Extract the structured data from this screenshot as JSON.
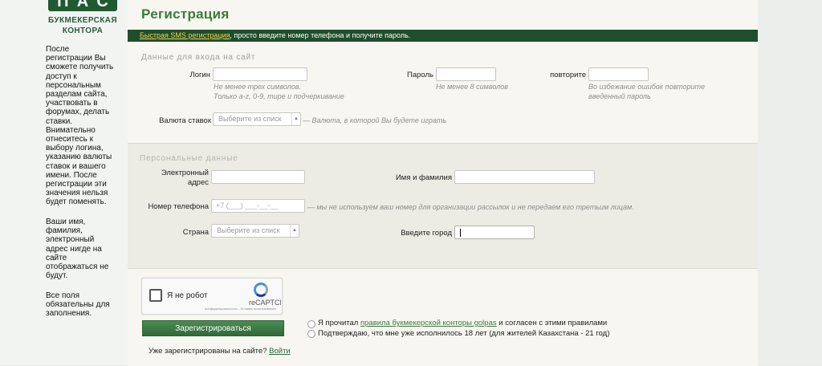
{
  "brand": {
    "logo_letters": [
      "П",
      "А",
      "С"
    ],
    "line1": "БУКМЕКЕРСКАЯ",
    "line2": "КОНТОРА",
    "color": "#1f5a32"
  },
  "sidebar": {
    "info_lines": [
      "После",
      "регистрации Вы",
      "сможете получить",
      "доступ к",
      "персональным",
      "разделам сайта,",
      "участвовать в",
      "форумах, делать",
      "ставки.",
      "Внимательно",
      "отнеситесь к",
      "выбору логина,",
      "указанию валюты",
      "ставок и вашего",
      "имени. После",
      "регистрации эти",
      "значения нельзя",
      "будет поменять."
    ],
    "privacy_lines": [
      "Ваши имя,",
      "фамилия,",
      "электронный",
      "адрес нигде на",
      "сайте",
      "отображаться не",
      "будут."
    ],
    "required_lines": [
      "Все поля",
      "обязательны для",
      "заполнения."
    ]
  },
  "title": "Регистрация",
  "sms": {
    "link": "Быстрая SMS регистрация",
    "text": ", просто введите номер телефона и получите пароль."
  },
  "login_section": {
    "legend": "Данные для входа на сайт",
    "login_label": "Логин",
    "login_hint_1": "Не менее трех символов.",
    "login_hint_2": "Только a-z, 0-9, тире и подчеркивание",
    "password_label": "Пароль",
    "password_hint": "Не менее 8 символов",
    "repeat_label": "повторите",
    "repeat_hint_1": "Во избежание ошибок повторите",
    "repeat_hint_2": "введенный пароль",
    "currency_label": "Валюта ставок",
    "currency_placeholder": "Выберите из списк",
    "currency_hint": "— Валюта, в которой Вы будете играть"
  },
  "personal_section": {
    "legend": "Персональные данные",
    "email_label_1": "Электронный",
    "email_label_2": "адрес",
    "name_label": "Имя и фамилия",
    "phone_label": "Номер телефона",
    "phone_mask": "+7 (___) ___-__-__",
    "phone_hint": "— мы не используем ваш номер для организации рассылок и не передаем его третьим лицам.",
    "country_label": "Страна",
    "country_placeholder": "Выберите из списк",
    "city_label": "Введите город"
  },
  "captcha": {
    "text": "Я не робот",
    "brand": "reCAPTCHA",
    "small": "Конфиденциальность - Условия использования"
  },
  "register_button": "Зарегистрироваться",
  "agreements": {
    "rules_prefix": "Я прочитал ",
    "rules_link": "правила букмекерской конторы golpas",
    "rules_suffix": " и согласен с этими правилами",
    "age": "Подтверждаю, что мне уже исполнилось 18 лет (для жителей Казахстана - 21 год)"
  },
  "already": {
    "text": "Уже зарегистрированы на сайте? ",
    "link": "Войти"
  }
}
